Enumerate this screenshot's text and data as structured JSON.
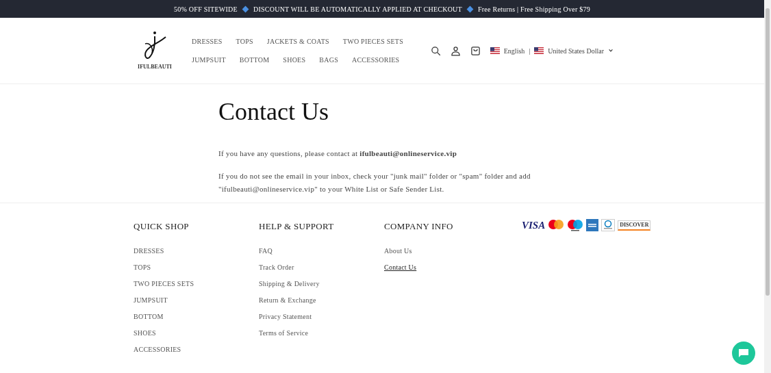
{
  "announcement": {
    "parts": [
      "50% OFF SITEWIDE",
      "DISCOUNT WILL BE AUTOMATICALLY APPLIED AT CHECKOUT",
      "Free Returns | Free Shipping Over $79"
    ]
  },
  "header": {
    "logo_text": "IFULBEAUTI",
    "nav_rows": [
      [
        {
          "label": "DRESSES"
        },
        {
          "label": "TOPS"
        },
        {
          "label": "JACKETS & COATS"
        },
        {
          "label": "TWO PIECES SETS"
        }
      ],
      [
        {
          "label": "JUMPSUIT"
        },
        {
          "label": "BOTTOM"
        },
        {
          "label": "SHOES"
        },
        {
          "label": "BAGS"
        },
        {
          "label": "ACCESSORIES"
        }
      ]
    ],
    "language": "English",
    "separator": "|",
    "currency": "United States Dollar"
  },
  "page": {
    "title": "Contact Us",
    "paragraphs": [
      "If you have any questions, please contact at **ifulbeauti@onlineservice.vip**",
      "If you do not see the email in your inbox, check your \"junk mail\" folder or \"spam\" folder and add \"ifulbeauti@onlineservice.vip\" to your White List or Safe Sender List."
    ]
  },
  "footer": {
    "columns": [
      {
        "heading": "QUICK SHOP",
        "links": [
          {
            "label": "DRESSES",
            "selected": false
          },
          {
            "label": "TOPS",
            "selected": false
          },
          {
            "label": "TWO PIECES SETS",
            "selected": false
          },
          {
            "label": "JUMPSUIT",
            "selected": false
          },
          {
            "label": "BOTTOM",
            "selected": false
          },
          {
            "label": "SHOES",
            "selected": false
          },
          {
            "label": "ACCESSORIES",
            "selected": false
          }
        ]
      },
      {
        "heading": "HELP & SUPPORT",
        "links": [
          {
            "label": "FAQ",
            "selected": false
          },
          {
            "label": "Track Order",
            "selected": false
          },
          {
            "label": "Shipping & Delivery",
            "selected": false
          },
          {
            "label": "Return & Exchange",
            "selected": false
          },
          {
            "label": "Privacy Statement",
            "selected": false
          },
          {
            "label": "Terms of Service",
            "selected": false
          }
        ]
      },
      {
        "heading": "COMPANY INFO",
        "links": [
          {
            "label": "About Us",
            "selected": false
          },
          {
            "label": "Contact Us",
            "selected": true
          }
        ]
      }
    ],
    "payments": [
      {
        "kind": "visa",
        "text": "VISA"
      },
      {
        "kind": "mastercard"
      },
      {
        "kind": "maestro"
      },
      {
        "kind": "amex"
      },
      {
        "kind": "diners"
      },
      {
        "kind": "discover",
        "text": "DISCOVER"
      }
    ]
  }
}
